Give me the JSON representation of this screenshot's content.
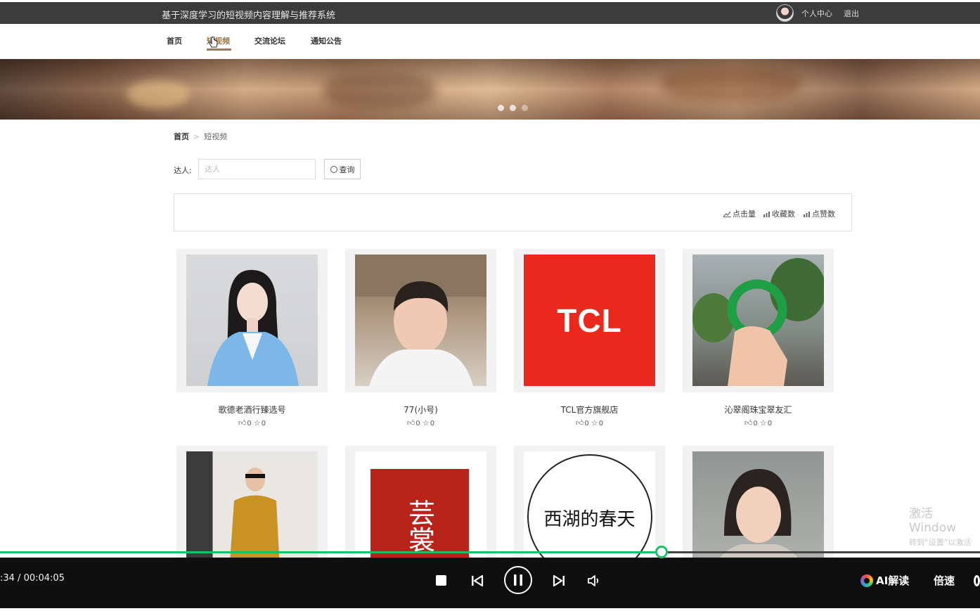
{
  "topbar": {
    "site_title": "基于深度学习的短视频内容理解与推荐系统",
    "user_center": "个人中心",
    "logout": "退出"
  },
  "nav": {
    "items": [
      {
        "label": "首页"
      },
      {
        "label": "短视频"
      },
      {
        "label": "交流论坛"
      },
      {
        "label": "通知公告"
      }
    ],
    "active_index": 1
  },
  "breadcrumb": {
    "home": "首页",
    "separator": ">",
    "current": "短视频"
  },
  "search": {
    "label": "达人:",
    "placeholder": "达人",
    "button_label": "查询"
  },
  "sort": {
    "items": [
      {
        "label": "点击量"
      },
      {
        "label": "收藏数"
      },
      {
        "label": "点赞数"
      }
    ]
  },
  "cards": [
    {
      "name": "歌德老酒行臻选号",
      "likes": "0",
      "stars": "0"
    },
    {
      "name": "77(小号)",
      "likes": "0",
      "stars": "0"
    },
    {
      "name": "TCL官方旗舰店",
      "likes": "0",
      "stars": "0"
    },
    {
      "name": "沁翠阁珠宝翠友汇",
      "likes": "0",
      "stars": "0"
    },
    {
      "name": "",
      "likes": "",
      "stars": ""
    },
    {
      "name": "",
      "likes": "",
      "stars": ""
    },
    {
      "name": "",
      "likes": "",
      "stars": ""
    },
    {
      "name": "",
      "likes": "",
      "stars": ""
    }
  ],
  "card_texts": {
    "tcl_logo": "TCL",
    "card6_chars": "芸裳",
    "card7_text": "西湖的春天"
  },
  "player": {
    "time": ":34 / 00:04:05",
    "progress": 0.675,
    "ai_label": "AI解读",
    "speed_label": "倍速"
  },
  "watermark": {
    "line1": "激活 Window",
    "line2": "转到“设置”以激活"
  },
  "colors": {
    "accent": "#9b7b52",
    "progress": "#1fbf6a",
    "topbar": "#3c3c3c"
  }
}
